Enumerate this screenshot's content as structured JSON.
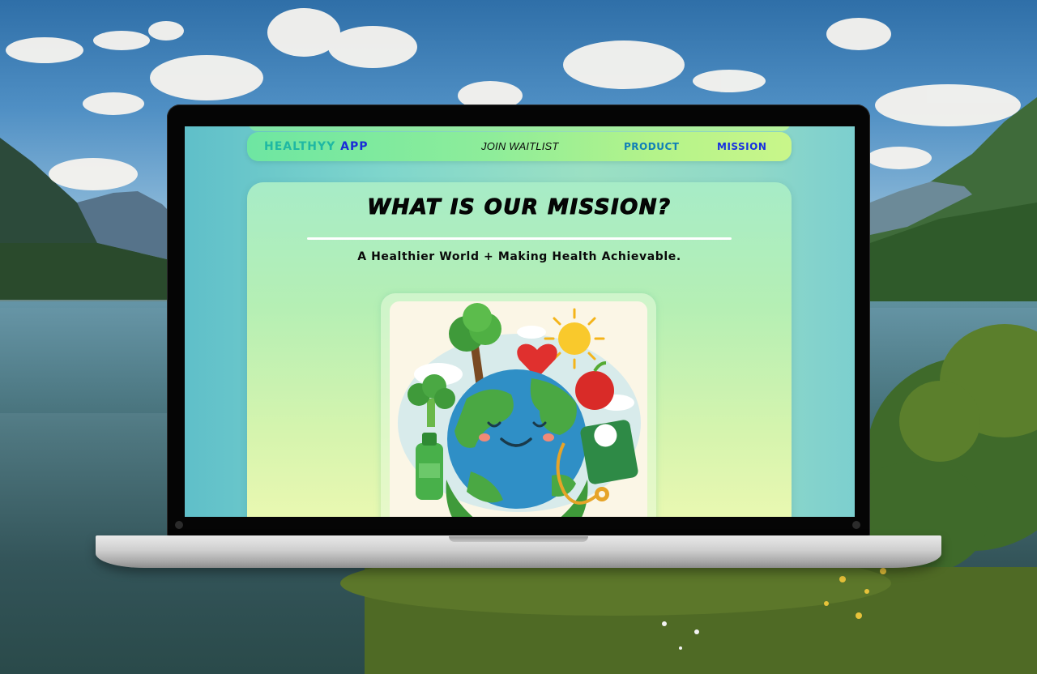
{
  "navbar": {
    "brand_part1": "HEALTHYY",
    "brand_part2": "APP",
    "join_waitlist": "JOIN WAITLIST",
    "product": "PRODUCT",
    "mission": "MISSION"
  },
  "mission": {
    "title": "WHAT IS OUR MISSION?",
    "subtitle": "A Healthier World + Making Health Achievable."
  },
  "colors": {
    "brand_teal": "#1fb8a3",
    "brand_blue": "#1a2bd9",
    "nav_product": "#0f7fb8",
    "nav_mission": "#1730e0"
  },
  "icons": {
    "illustration": "smiling-earth-health-illustration"
  }
}
